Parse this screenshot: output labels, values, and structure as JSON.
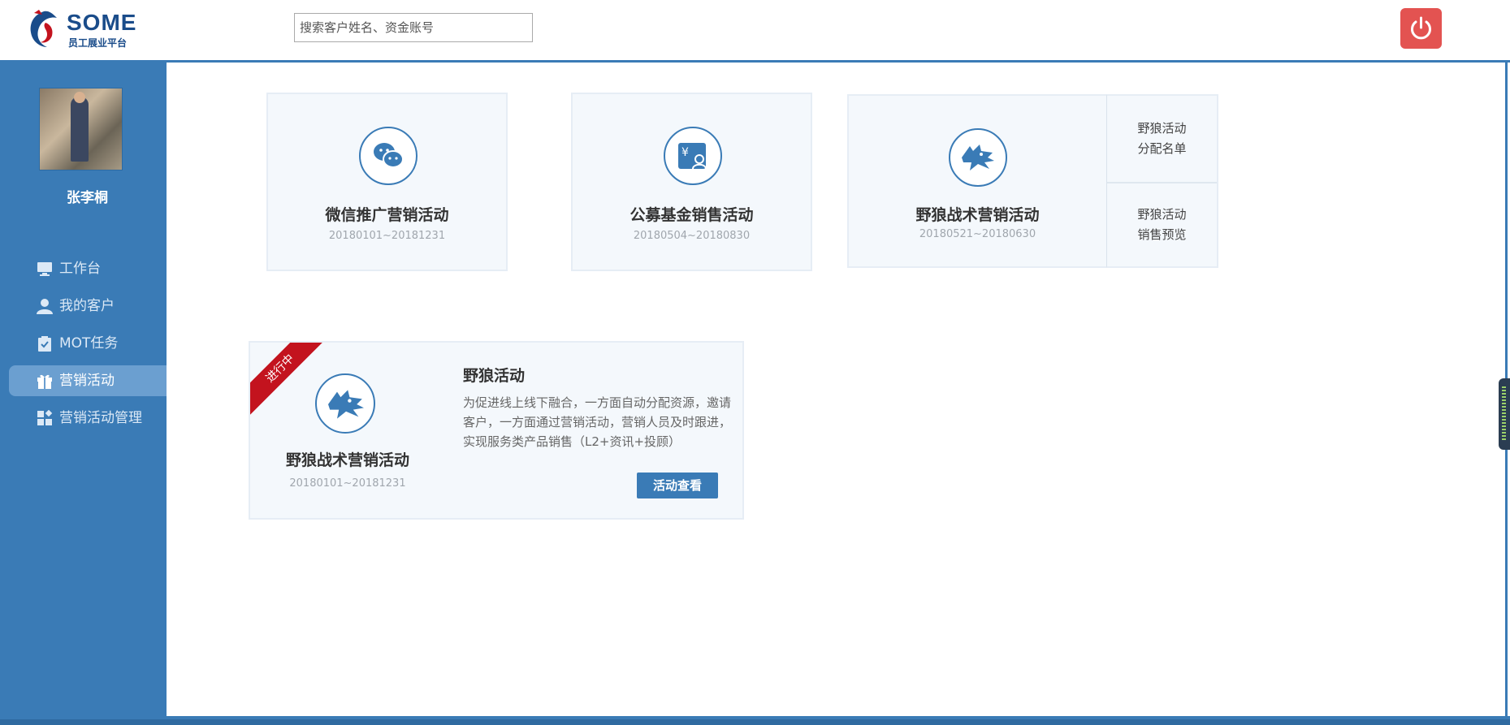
{
  "header": {
    "brand": "SOME",
    "subtitle": "员工展业平台",
    "search_placeholder": "搜索客户姓名、资金账号"
  },
  "sidebar": {
    "user_name": "张李桐",
    "items": [
      {
        "label": "工作台",
        "icon": "monitor-icon"
      },
      {
        "label": "我的客户",
        "icon": "user-icon"
      },
      {
        "label": "MOT任务",
        "icon": "clipboard-icon"
      },
      {
        "label": "营销活动",
        "icon": "gift-icon",
        "active": true
      },
      {
        "label": "营销活动管理",
        "icon": "grid-icon"
      }
    ]
  },
  "cards": [
    {
      "title": "微信推广营销活动",
      "date": "20180101~20181231",
      "icon": "wechat-icon"
    },
    {
      "title": "公募基金销售活动",
      "date": "20180504~20180830",
      "icon": "fund-icon"
    },
    {
      "title": "野狼战术营销活动",
      "date": "20180521~20180630",
      "icon": "wolf-icon"
    }
  ],
  "side_links": {
    "top": "野狼活动分配名单",
    "bottom": "野狼活动销售预览"
  },
  "featured": {
    "ribbon": "进行中",
    "name": "野狼战术营销活动",
    "date": "20180101~20181231",
    "activity_title": "野狼活动",
    "description": "为促进线上线下融合，一方面自动分配资源，邀请客户，一方面通过营销活动，营销人员及时跟进，实现服务类产品销售（L2+资讯+投顾）",
    "button": "活动查看"
  },
  "colors": {
    "primary": "#3a7bb6",
    "power": "#e35351",
    "ribbon": "#c3131e"
  }
}
